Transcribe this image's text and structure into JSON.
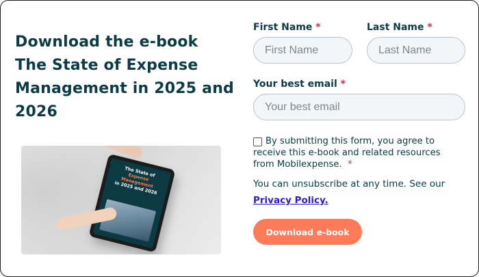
{
  "headline": {
    "line1": "Download the e-book",
    "line2": "The State of Expense",
    "line3": "Management in 2025 and",
    "line4": "2026"
  },
  "ebook_cover": {
    "line1": "The State of",
    "line2": "Expense Management",
    "line3": "in 2025 and 2026"
  },
  "form": {
    "first_name": {
      "label": "First Name",
      "required_mark": "*",
      "placeholder": "First Name"
    },
    "last_name": {
      "label": "Last Name",
      "required_mark": "*",
      "placeholder": "Last Name"
    },
    "email": {
      "label": "Your best email",
      "required_mark": "*",
      "placeholder": "Your best email"
    },
    "consent": {
      "text": "By submitting this form, you agree to receive this e-book and related resources from Mobilexpense.",
      "required_mark": "*"
    },
    "unsubscribe_text": "You can unsubscribe at any time. See our",
    "privacy_link": "Privacy Policy.",
    "submit_label": "Download e-book"
  },
  "colors": {
    "heading": "#0b3b44",
    "required": "#e5244b",
    "button": "#ff7a59",
    "link": "#2b1be0"
  }
}
